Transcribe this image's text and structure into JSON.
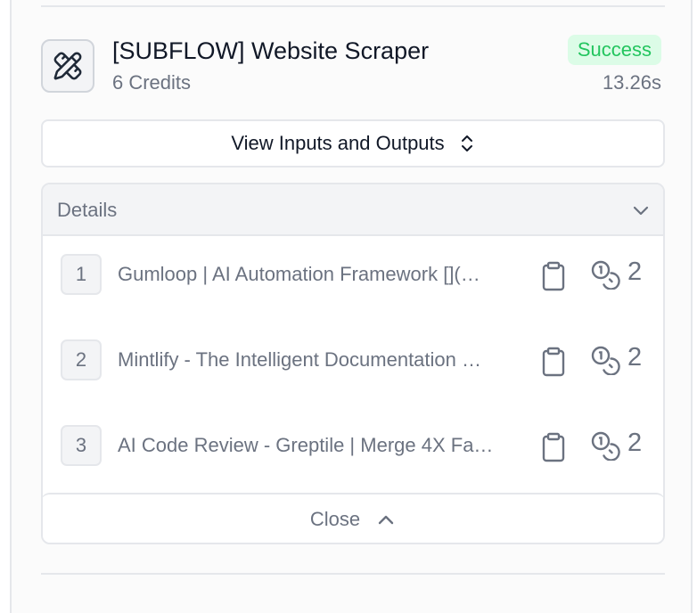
{
  "node": {
    "icon": "pencil-ruler-icon",
    "title": "[SUBFLOW] Website Scraper",
    "credits": "6 Credits",
    "status": "Success",
    "duration": "13.26s"
  },
  "io_button": {
    "label": "View Inputs and Outputs",
    "icon": "chevron-up-down-icon"
  },
  "details": {
    "title": "Details",
    "icon": "chevron-down-icon",
    "rows": [
      {
        "index": "1",
        "text": "Gumloop | AI Automation Framework [](…",
        "credits": "2"
      },
      {
        "index": "2",
        "text": "Mintlify - The Intelligent Documentation …",
        "credits": "2"
      },
      {
        "index": "3",
        "text": "AI Code Review - Greptile | Merge 4X Fa…",
        "credits": "2"
      }
    ],
    "close_label": "Close"
  },
  "colors": {
    "success_text": "#22c55e",
    "success_bg": "#dcfce7",
    "muted_text": "#6b7280",
    "border": "#e5e7eb"
  }
}
